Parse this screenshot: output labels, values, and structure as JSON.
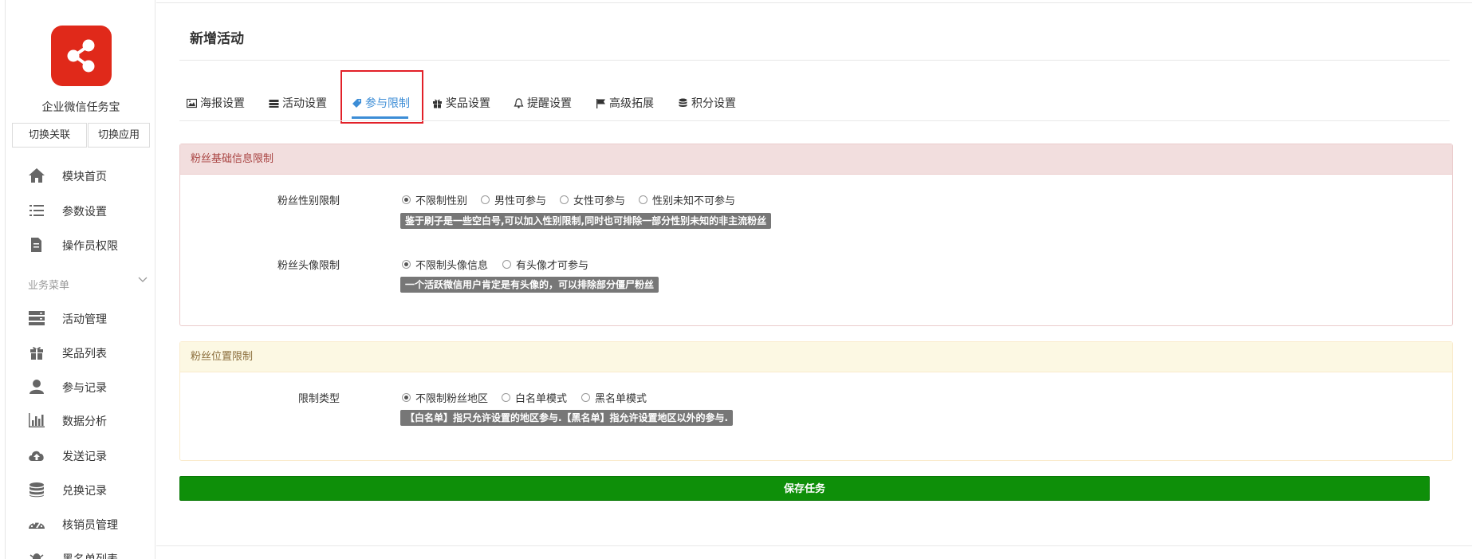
{
  "sidebar": {
    "app_name": "企业微信任务宝",
    "logo_icon": "share-icon",
    "switch_link_label": "切换关联",
    "switch_app_label": "切换应用",
    "top_items": [
      {
        "label": "模块首页",
        "icon": "home-icon"
      },
      {
        "label": "参数设置",
        "icon": "list-settings-icon"
      },
      {
        "label": "操作员权限",
        "icon": "edit-document-icon"
      }
    ],
    "group_label": "业务菜单",
    "group_items": [
      {
        "label": "活动管理",
        "icon": "server-stack-icon"
      },
      {
        "label": "奖品列表",
        "icon": "gift-icon"
      },
      {
        "label": "参与记录",
        "icon": "user-icon"
      },
      {
        "label": "数据分析",
        "icon": "bar-chart-icon"
      },
      {
        "label": "发送记录",
        "icon": "cloud-upload-icon"
      },
      {
        "label": "兑换记录",
        "icon": "database-icon"
      },
      {
        "label": "核销员管理",
        "icon": "dashboard-icon"
      },
      {
        "label": "黑名单列表",
        "icon": "bug-icon"
      }
    ]
  },
  "main": {
    "title": "新增活动",
    "tabs": [
      {
        "label": "海报设置",
        "icon": "image-icon"
      },
      {
        "label": "活动设置",
        "icon": "server-icon"
      },
      {
        "label": "参与限制",
        "icon": "tag-icon"
      },
      {
        "label": "奖品设置",
        "icon": "gift-icon"
      },
      {
        "label": "提醒设置",
        "icon": "bell-icon"
      },
      {
        "label": "高级拓展",
        "icon": "flag-icon"
      },
      {
        "label": "积分设置",
        "icon": "database-icon"
      }
    ],
    "active_tab": "参与限制",
    "panel_basic": {
      "header": "粉丝基础信息限制",
      "gender": {
        "label": "粉丝性别限制",
        "options": [
          "不限制性别",
          "男性可参与",
          "女性可参与",
          "性别未知不可参与"
        ],
        "selected": "不限制性别",
        "hint": "鉴于刷子是一些空白号,可以加入性别限制,同时也可排除一部分性别未知的非主流粉丝"
      },
      "avatar": {
        "label": "粉丝头像限制",
        "options": [
          "不限制头像信息",
          "有头像才可参与"
        ],
        "selected": "不限制头像信息",
        "hint": "一个活跃微信用户肯定是有头像的，可以排除部分僵尸粉丝"
      }
    },
    "panel_location": {
      "header": "粉丝位置限制",
      "type": {
        "label": "限制类型",
        "options": [
          "不限制粉丝地区",
          "白名单模式",
          "黑名单模式"
        ],
        "selected": "不限制粉丝地区",
        "hint": "【白名单】指只允许设置的地区参与.【黑名单】指允许设置地区以外的参与."
      }
    },
    "save_label": "保存任务"
  },
  "colors": {
    "brand_red": "#e0291a",
    "active_tab": "#3c8dd6",
    "save_green": "#0e8f09",
    "highlight_box": "#e22028"
  }
}
